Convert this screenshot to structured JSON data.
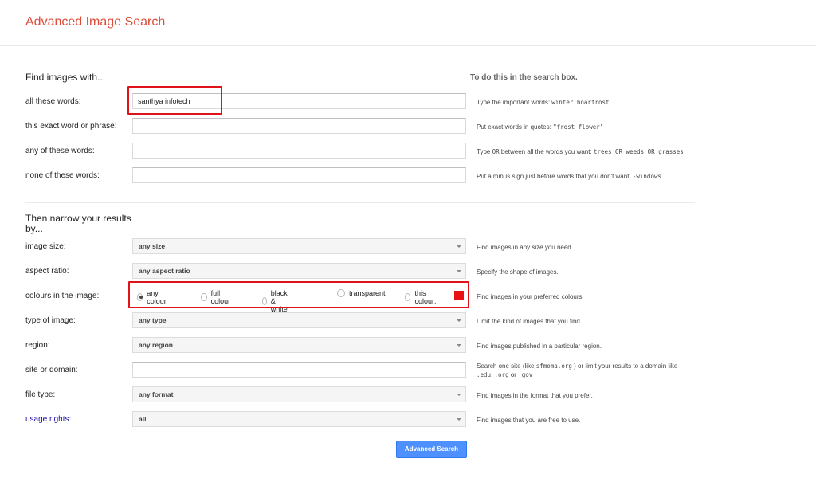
{
  "header": {
    "title": "Advanced Image Search"
  },
  "find_section": {
    "heading": "Find images with...",
    "hint_heading": "To do this in the search box.",
    "rows": [
      {
        "label": "all these words:",
        "value": "santhya infotech",
        "hint_text": "Type the important words:",
        "hint_example": "winter hoarfrost"
      },
      {
        "label": "this exact word or phrase:",
        "value": "",
        "hint_text": "Put exact words in quotes:",
        "hint_example": "\"frost flower\""
      },
      {
        "label": "any of these words:",
        "value": "",
        "hint_text": "Type",
        "hint_or1": "OR",
        "hint_mid": "between all the words you want:",
        "hint_example": "trees OR weeds OR grasses"
      },
      {
        "label": "none of these words:",
        "value": "",
        "hint_text": "Put a minus sign just before words that you don't want:",
        "hint_example": "-windows"
      }
    ]
  },
  "narrow_section": {
    "heading_line1": "Then narrow your results",
    "heading_line2": "by...",
    "image_size": {
      "label": "image size:",
      "value": "any size",
      "hint": "Find images in any size you need."
    },
    "aspect_ratio": {
      "label": "aspect ratio:",
      "value": "any aspect ratio",
      "hint": "Specify the shape of images."
    },
    "colours": {
      "label": "colours in the image:",
      "options": [
        "any colour",
        "full colour",
        "black & white",
        "transparent",
        "this colour:"
      ],
      "selected": "any colour",
      "swatch_color": "#e81010",
      "hint": "Find images in your preferred colours."
    },
    "type_of_image": {
      "label": "type of image:",
      "value": "any type",
      "hint": "Limit the kind of images that you find."
    },
    "region": {
      "label": "region:",
      "value": "any region",
      "hint": "Find images published in a particular region."
    },
    "site_or_domain": {
      "label": "site or domain:",
      "value": "",
      "hint_a": "Search one site (like",
      "hint_site": "sfmoma.org",
      "hint_b": ") or limit your results to a domain like",
      "hint_edu": ".edu",
      "hint_c": ",",
      "hint_org": ".org",
      "hint_d": "or",
      "hint_gov": ".gov"
    },
    "file_type": {
      "label": "file type:",
      "value": "any format",
      "hint": "Find images in the format that you prefer."
    },
    "usage_rights": {
      "label": "usage rights:",
      "value": "all",
      "hint": "Find images that you are free to use."
    }
  },
  "submit": {
    "label": "Advanced Search"
  },
  "colors": {
    "title_red": "#dd4b39",
    "button_blue": "#4d90fe",
    "highlight_red": "#e0131b",
    "link_blue": "#1a0dab"
  }
}
